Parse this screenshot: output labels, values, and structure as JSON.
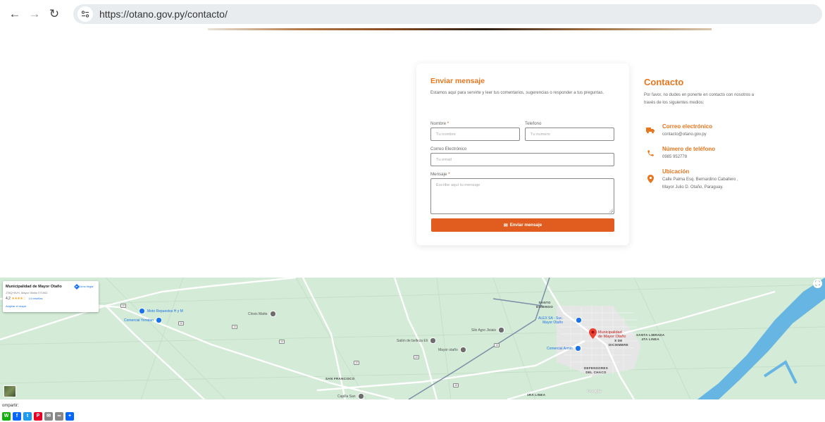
{
  "browser": {
    "url": "https://otano.gov.py/contacto/"
  },
  "form": {
    "title": "Enviar mensaje",
    "description": "Estamos aquí para servirte y leer tus comentarios, sugerencias o responder a tus preguntas.",
    "name_label": "Nombre",
    "name_placeholder": "Tu nombre",
    "phone_label": "Telefono",
    "phone_placeholder": "Tu numero",
    "email_label": "Correo Electrónico",
    "email_placeholder": "Tu email",
    "message_label": "Mensaje",
    "message_placeholder": "Escribe aquí tu mensaje",
    "required_mark": "*",
    "submit_label": "Enviar mensaje"
  },
  "contact": {
    "title": "Contacto",
    "description": "Por favor, no dudes en ponerte en contacto con nosotros a través de los siguientes medios:",
    "items": [
      {
        "title": "Correo electrónico",
        "lines": [
          "contacto@otano.gov.py"
        ],
        "icon": "truck-icon"
      },
      {
        "title": "Número de teléfono",
        "lines": [
          "0985 952778"
        ],
        "icon": "phone-icon"
      },
      {
        "title": "Ubicación",
        "lines": [
          "Calle Palma Esq. Bernardino Caballero ,",
          "Mayor Julio D. Otaño, Paraguay."
        ],
        "icon": "location-pin-icon"
      }
    ]
  },
  "map": {
    "card": {
      "name": "Municipalidad de Mayor Otaño",
      "address": "J78Q+6VH, Mayor Otaño 071902",
      "rating": "4,2",
      "stars": "★★★★☆",
      "reviews": "14 reseñas",
      "enlarge": "Ampliar el mapa",
      "directions": "Cómo llegar"
    },
    "places": {
      "moto": "Moto Repuestos H y M",
      "comercial_yonatan": "Comercial Yonatan",
      "clovis": "Clovis Matte",
      "silo": "Silo Agro Jisiais",
      "salon": "Salón de belleza Eli",
      "mayor_otano": "Mayor otaño",
      "alex_1": "ALEX SA - Suc.",
      "alex_2": "Mayor Otaño",
      "comercial_armin": "Comercial Armin",
      "muni_1": "Municipalidad",
      "muni_2": "de Mayor Otaño",
      "santo_1": "SANTO",
      "santo_2": "DOMINGO",
      "ocho_1": "8 DE",
      "ocho_2": "DICIEMBRE",
      "santa_1": "SANTA LIBRADA",
      "santa_2": "4TA LINEA",
      "defensores_1": "DEFENSORES",
      "defensores_2": "DEL CHACO",
      "san_francisco": "SAN FRANCISCO",
      "capilla": "Capilla San",
      "tra_linea": "1RA LINEA",
      "google": "Google"
    },
    "routes": [
      "10",
      "10",
      "10",
      "10",
      "10",
      "10",
      "10",
      "10"
    ],
    "colors": {
      "land": "#d3ebd7",
      "water": "#66b5e3",
      "road": "#ffffff",
      "pin": "#ea4335"
    }
  },
  "share": {
    "label": "ompartir:",
    "buttons": [
      {
        "name": "whatsapp",
        "color": "#12af0a",
        "glyph": "W"
      },
      {
        "name": "facebook",
        "color": "#0866ff",
        "glyph": "f"
      },
      {
        "name": "twitter",
        "color": "#1d9bf0",
        "glyph": "t"
      },
      {
        "name": "pinterest",
        "color": "#e60023",
        "glyph": "P"
      },
      {
        "name": "email",
        "color": "#888888",
        "glyph": "✉"
      },
      {
        "name": "copy-link",
        "color": "#888888",
        "glyph": "∞"
      },
      {
        "name": "more",
        "color": "#0166ff",
        "glyph": "+"
      }
    ]
  }
}
